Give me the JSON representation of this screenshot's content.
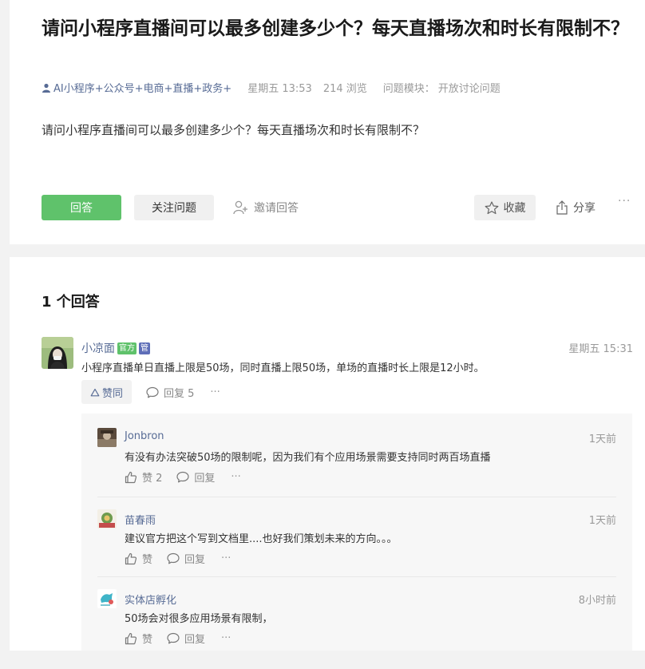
{
  "question": {
    "title": "请问小程序直播间可以最多创建多少个？每天直播场次和时长有限制不？",
    "author": "AI小程序+公众号+电商+直播+政务+",
    "time": "星期五 13:53",
    "views": "214 浏览",
    "module_label": "问题模块：",
    "module_value": "开放讨论问题",
    "body": "请问小程序直播间可以最多创建多少个？每天直播场次和时长有限制不？"
  },
  "actions": {
    "answer_label": "回答",
    "follow_label": "关注问题",
    "invite_label": "邀请回答",
    "collect_label": "收藏",
    "share_label": "分享",
    "more_label": "···"
  },
  "answers_header": {
    "count_label": "1 个回答"
  },
  "answer": {
    "name": "小凉面",
    "badge_official": "官方",
    "badge_admin": "管",
    "time": "星期五 15:31",
    "content": "小程序直播单日直播上限是50场，同时直播上限50场，单场的直播时长上限是12小时。",
    "agree_label": "赞同",
    "reply_label": "回复 5",
    "more_label": "···"
  },
  "replies": [
    {
      "name": "Jonbron",
      "time": "1天前",
      "content": "有没有办法突破50场的限制呢，因为我们有个应用场景需要支持同时两百场直播",
      "like_label": "赞 2",
      "reply_label": "回复",
      "more_label": "···"
    },
    {
      "name": "苗春雨",
      "time": "1天前",
      "content": "建议官方把这个写到文档里....也好我们策划未来的方向。。。",
      "like_label": "赞",
      "reply_label": "回复",
      "more_label": "···"
    },
    {
      "name": "实体店孵化",
      "time": "8小时前",
      "content": "50场会对很多应用场景有限制，",
      "like_label": "赞",
      "reply_label": "回复",
      "more_label": "···"
    }
  ],
  "colors": {
    "accent_green": "#5fc26b",
    "link_blue": "#576b95",
    "admin_badge": "#5e6eb8"
  }
}
